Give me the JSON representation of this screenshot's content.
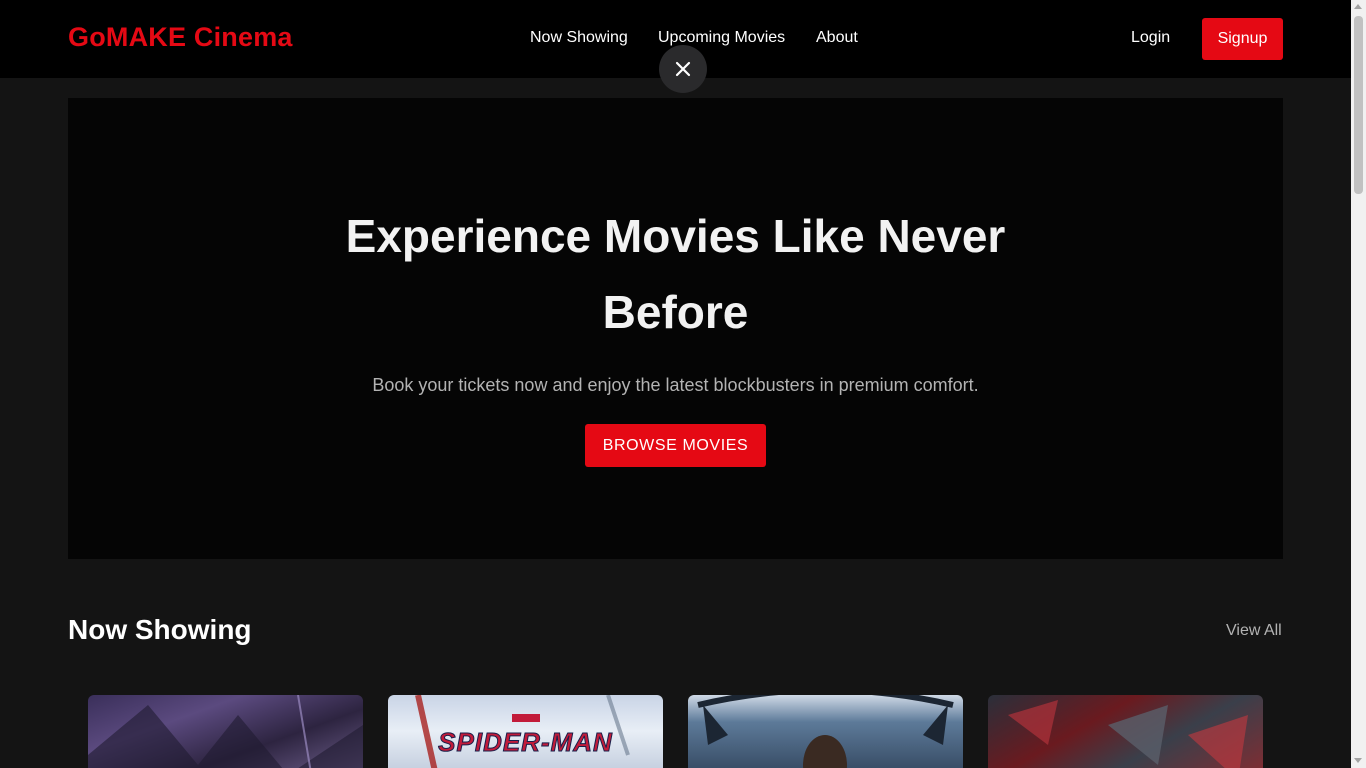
{
  "header": {
    "logo": "GoMAKE Cinema",
    "nav": {
      "now_showing": "Now Showing",
      "upcoming": "Upcoming Movies",
      "about": "About"
    },
    "login": "Login",
    "signup": "Signup"
  },
  "overlay": {
    "close_icon": "close-icon"
  },
  "hero": {
    "title": "Experience Movies Like Never Before",
    "subtitle": "Book your tickets now and enjoy the latest blockbusters in premium comfort.",
    "cta": "BROWSE MOVIES"
  },
  "now_showing": {
    "title": "Now Showing",
    "view_all": "View All",
    "posters": [
      {
        "art": "dark purple action poster"
      },
      {
        "art": "Spider-Man poster",
        "title_text": "SPIDER-MAN"
      },
      {
        "art": "Black Panther poster"
      },
      {
        "art": "shattered glass red poster"
      }
    ]
  },
  "colors": {
    "brand": "#e50914",
    "background": "#141414",
    "navbar": "#000000",
    "hero_bg": "#050505",
    "muted_text": "#b3b3b3"
  }
}
